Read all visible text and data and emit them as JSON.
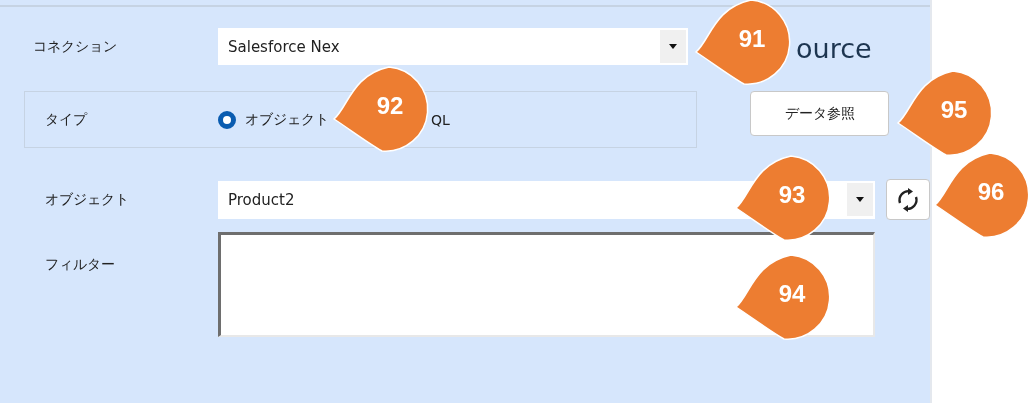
{
  "title": "ource",
  "connection": {
    "label": "コネクション",
    "value": "Salesforce Nex"
  },
  "type": {
    "label": "タイプ",
    "options": [
      {
        "label": "オブジェクト",
        "selected": true
      }
    ],
    "partial_option": "QL"
  },
  "browse_button": "データ参照",
  "object": {
    "label": "オブジェクト",
    "value": "Product2"
  },
  "filter": {
    "label": "フィルター"
  },
  "callouts": [
    {
      "label": "91"
    },
    {
      "label": "92"
    },
    {
      "label": "93"
    },
    {
      "label": "94"
    },
    {
      "label": "95"
    },
    {
      "label": "96"
    }
  ]
}
